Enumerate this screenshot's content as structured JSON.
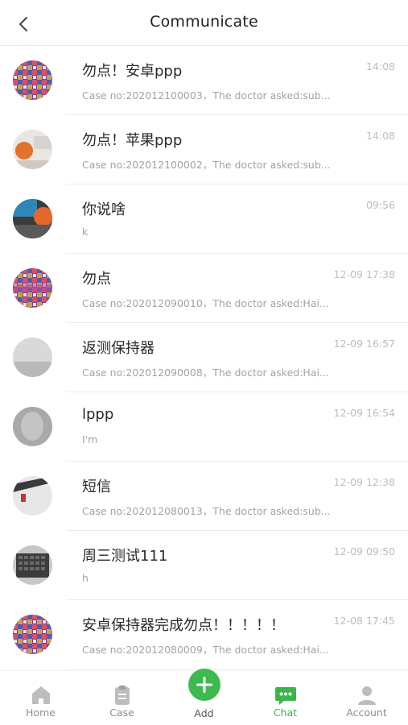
{
  "header": {
    "title": "Communicate"
  },
  "colors": {
    "accent": "#3bb54a",
    "divider": "#ececec",
    "muted": "#a3a3a3"
  },
  "conversations": [
    {
      "title": "勿点！安卓ppp",
      "preview": "Case no:202012100003，The doctor asked:sub...",
      "time": "14:08",
      "avatar": "colorful-bags-avatar"
    },
    {
      "title": "勿点！苹果ppp",
      "preview": "Case no:202012100002，The doctor asked:sub...",
      "time": "14:08",
      "avatar": "orange-fruit-avatar"
    },
    {
      "title": "你说啥",
      "preview": "k",
      "time": "09:56",
      "avatar": "blue-orange-avatar"
    },
    {
      "title": "勿点",
      "preview": "Case no:202012090010，The doctor asked:Hai...",
      "time": "12-09 17:38",
      "avatar": "colorful-bags-avatar"
    },
    {
      "title": "返测保持器",
      "preview": "Case no:202012090008，The doctor asked:Hai...",
      "time": "12-09 16:57",
      "avatar": "grey-wall-avatar"
    },
    {
      "title": "lppp",
      "preview": "I'm",
      "time": "12-09 16:54",
      "avatar": "blurred-avatar"
    },
    {
      "title": "短信",
      "preview": "Case no:202012080013，The doctor asked:sub...",
      "time": "12-09 12:38",
      "avatar": "desk-avatar"
    },
    {
      "title": "周三测试111",
      "preview": "h",
      "time": "12-09 09:50",
      "avatar": "keyboard-avatar"
    },
    {
      "title": "安卓保持器完成勿点！！！！！",
      "preview": "Case no:202012080009，The doctor asked:Hai...",
      "time": "12-08 17:45",
      "avatar": "colorful-bags-avatar"
    }
  ],
  "tabbar": {
    "home": "Home",
    "case": "Case",
    "add": "Add",
    "chat": "Chat",
    "account": "Account"
  }
}
